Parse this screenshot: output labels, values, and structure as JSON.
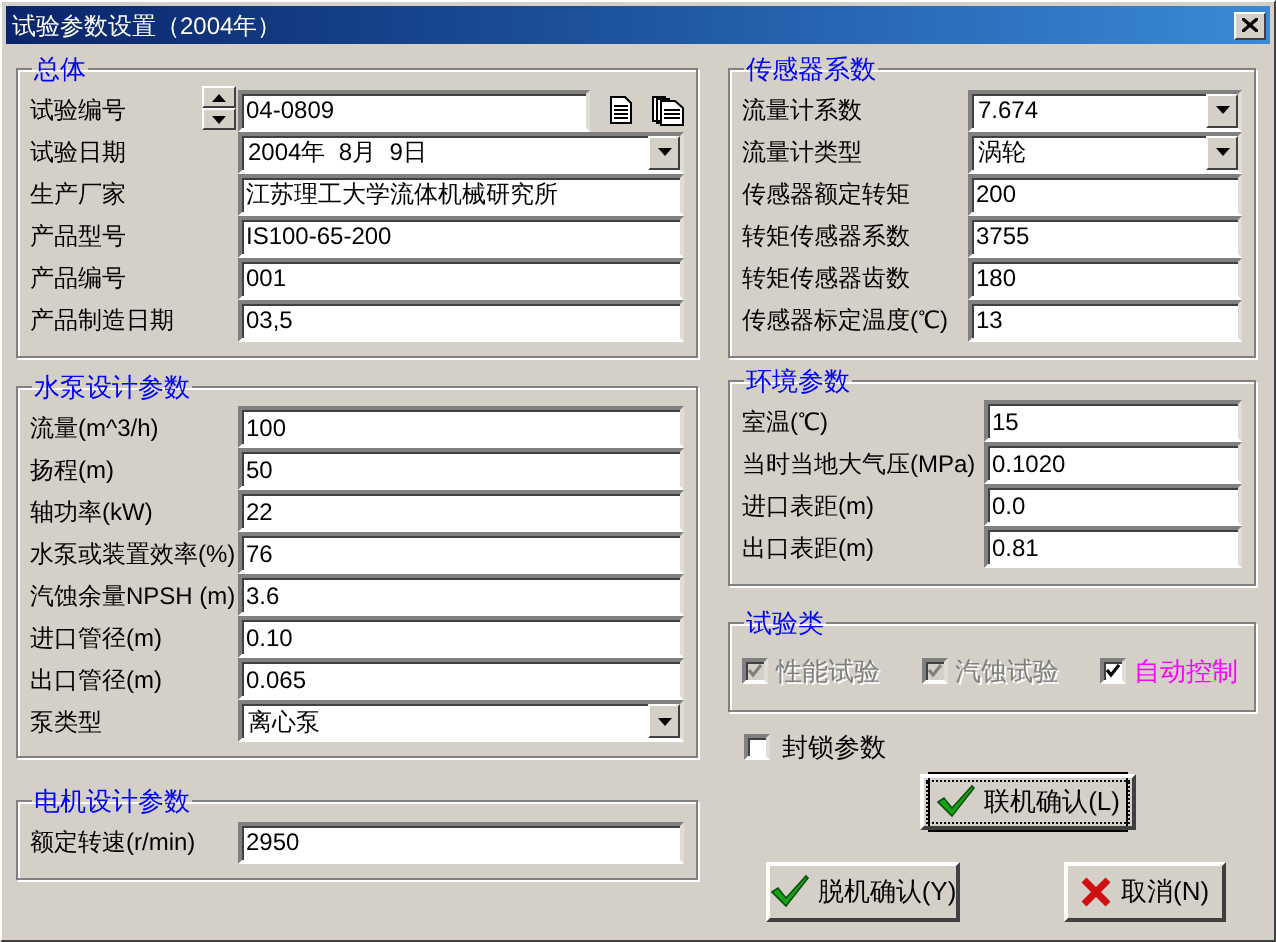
{
  "window": {
    "title": "试验参数设置（2004年）"
  },
  "general": {
    "title": "总体",
    "fields": [
      {
        "label": "试验编号",
        "kind": "spinner",
        "value": "04-0809"
      },
      {
        "label": "试验日期",
        "kind": "dropdown",
        "value": "2004年  8月  9日"
      },
      {
        "label": "生产厂家",
        "kind": "text",
        "value": "江苏理工大学流体机械研究所"
      },
      {
        "label": "产品型号",
        "kind": "text",
        "value": "IS100-65-200"
      },
      {
        "label": "产品编号",
        "kind": "text",
        "value": "001"
      },
      {
        "label": "产品制造日期",
        "kind": "text",
        "value": "03,5"
      }
    ]
  },
  "pump_design": {
    "title": "水泵设计参数",
    "fields": [
      {
        "label": "流量(m^3/h)",
        "kind": "text",
        "value": "100"
      },
      {
        "label": "扬程(m)",
        "kind": "text",
        "value": "50"
      },
      {
        "label": "轴功率(kW)",
        "kind": "text",
        "value": "22"
      },
      {
        "label": "水泵或装置效率(%)",
        "kind": "text",
        "value": "76"
      },
      {
        "label": "汽蚀余量NPSH (m)",
        "kind": "text",
        "value": "3.6"
      },
      {
        "label": "进口管径(m)",
        "kind": "text",
        "value": "0.10"
      },
      {
        "label": "出口管径(m)",
        "kind": "text",
        "value": "0.065"
      },
      {
        "label": "泵类型",
        "kind": "dropdown",
        "value": "离心泵"
      }
    ]
  },
  "motor_design": {
    "title": "电机设计参数",
    "fields": [
      {
        "label": "额定转速(r/min)",
        "kind": "text",
        "value": "2950"
      }
    ]
  },
  "sensor_coefficients": {
    "title": "传感器系数",
    "fields": [
      {
        "label": "流量计系数",
        "kind": "dropdown",
        "value": "7.674"
      },
      {
        "label": "流量计类型",
        "kind": "dropdown",
        "value": "涡轮"
      },
      {
        "label": "传感器额定转矩",
        "kind": "text",
        "value": "200"
      },
      {
        "label": "转矩传感器系数",
        "kind": "text",
        "value": "3755"
      },
      {
        "label": "转矩传感器齿数",
        "kind": "text",
        "value": "180"
      },
      {
        "label": "传感器标定温度(℃)",
        "kind": "text",
        "value": "13"
      }
    ]
  },
  "environment": {
    "title": "环境参数",
    "fields": [
      {
        "label": "室温(℃)",
        "kind": "text",
        "value": "15"
      },
      {
        "label": "当时当地大气压(MPa)",
        "kind": "text",
        "value": "0.1020"
      },
      {
        "label": "进口表距(m)",
        "kind": "text",
        "value": "0.0"
      },
      {
        "label": "出口表距(m)",
        "kind": "text",
        "value": "0.81"
      }
    ]
  },
  "test_types": {
    "title": "试验类",
    "items": [
      {
        "label": "性能试验",
        "checked": true,
        "disabled": true
      },
      {
        "label": "汽蚀试验",
        "checked": true,
        "disabled": true
      },
      {
        "label": "自动控制",
        "checked": true,
        "disabled": false,
        "color": "#ff00ff"
      }
    ]
  },
  "lock_parameters": {
    "label": "封锁参数",
    "checked": false
  },
  "buttons": [
    {
      "label": "联机确认(L)",
      "kind": "confirm",
      "default": true
    },
    {
      "label": "脱机确认(Y)",
      "kind": "confirm",
      "default": false
    },
    {
      "label": "取消(N)",
      "kind": "cancel",
      "default": false
    }
  ]
}
